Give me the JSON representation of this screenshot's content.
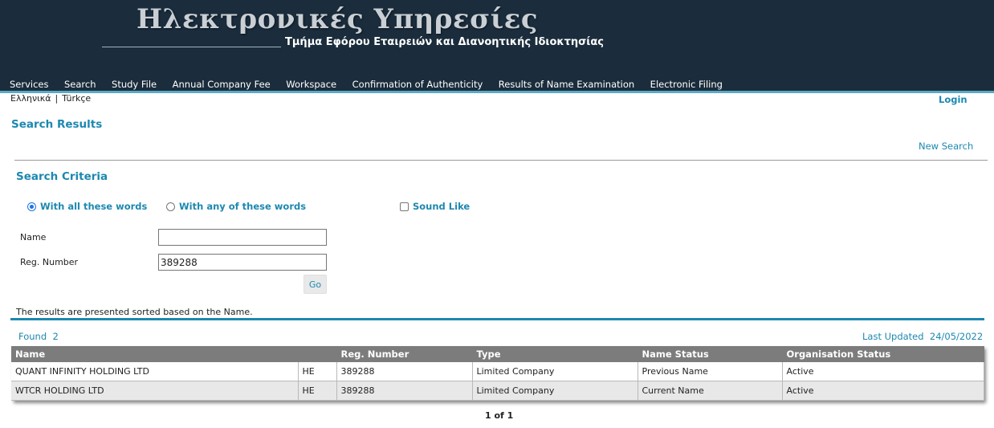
{
  "header": {
    "title": "Ηλεκτρονικές Υπηρεσίες",
    "subtitle": "Τμήμα Εφόρου Εταιρειών και Διανοητικής Ιδιοκτησίας"
  },
  "nav": [
    "Services",
    "Search",
    "Study File",
    "Annual Company Fee",
    "Workspace",
    "Confirmation of Authenticity",
    "Results of Name Examination",
    "Electronic Filing"
  ],
  "lang": {
    "greek": "Ελληνικά",
    "turkish": "Türkçe",
    "separator": "|"
  },
  "login": "Login",
  "page_title": "Search Results",
  "new_search": "New Search",
  "criteria": {
    "title": "Search Criteria",
    "option_all": "With all these words",
    "option_any": "With any of these words",
    "sound_like": "Sound Like",
    "selected_option": "all",
    "sound_like_checked": false,
    "name_label": "Name",
    "name_value": "",
    "reg_label": "Reg. Number",
    "reg_value": "389288",
    "go_label": "Go"
  },
  "sort_note": "The results are presented sorted based on the Name.",
  "found_label": "Found",
  "found_count": "2",
  "updated_label": "Last Updated",
  "updated_value": "24/05/2022",
  "table": {
    "headers": [
      "Name",
      "",
      "Reg. Number",
      "Type",
      "Name Status",
      "Organisation Status"
    ],
    "rows": [
      [
        "QUANT INFINITY HOLDING LTD",
        "HE",
        "389288",
        "Limited Company",
        "Previous Name",
        "Active"
      ],
      [
        "WTCR HOLDING LTD",
        "HE",
        "389288",
        "Limited Company",
        "Current Name",
        "Active"
      ]
    ]
  },
  "pager": "1 of 1",
  "colors": {
    "header_bg": "#1b2d3c",
    "accent": "#1d88b0",
    "table_header_bg": "#7c7c7c",
    "row_alt_bg": "#e8e8e8"
  }
}
